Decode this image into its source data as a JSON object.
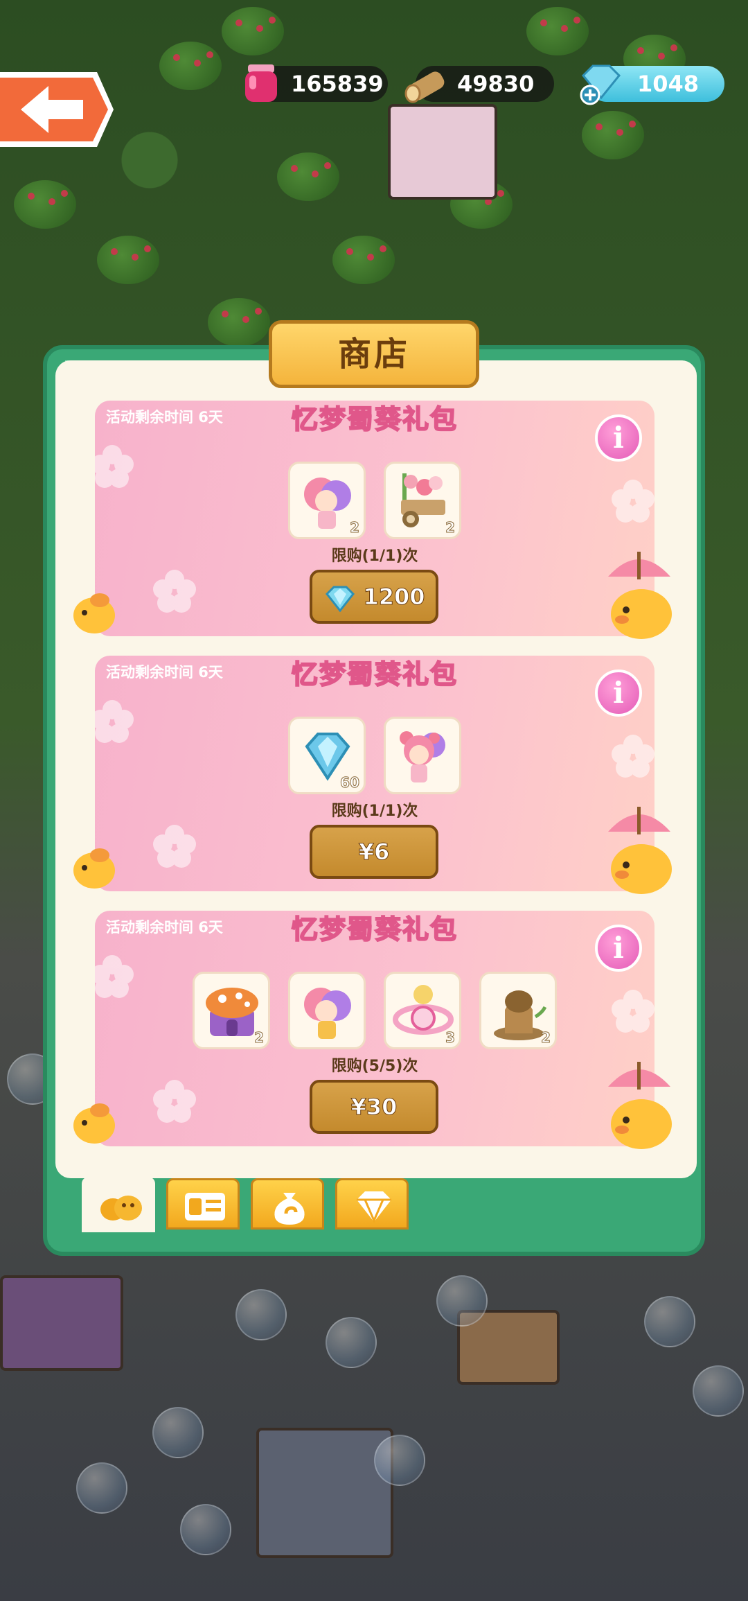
{
  "resources": {
    "potion": {
      "value": "165839",
      "icon": "pink-potion-jar-icon"
    },
    "wood": {
      "value": "49830",
      "icon": "wood-log-icon"
    },
    "gems": {
      "value": "1048",
      "icon": "blue-gem-add-icon"
    }
  },
  "shop": {
    "title": "商店",
    "cards": [
      {
        "timer": "活动剩余时间  6天",
        "title": "忆梦蜀葵礼包",
        "items": [
          {
            "icon": "pink-purple-hair-character-icon",
            "qty": "2"
          },
          {
            "icon": "flower-cart-decoration-icon",
            "qty": "2"
          }
        ],
        "limit": "限购(1/1)次",
        "price": "1200",
        "price_icon": "gem-icon"
      },
      {
        "timer": "活动剩余时间  6天",
        "title": "忆梦蜀葵礼包",
        "items": [
          {
            "icon": "blue-gem-pack-icon",
            "qty": "60"
          },
          {
            "icon": "pink-girl-character-icon",
            "qty": ""
          }
        ],
        "limit": "限购(1/1)次",
        "price": "¥6",
        "price_icon": ""
      },
      {
        "timer": "活动剩余时间  6天",
        "title": "忆梦蜀葵礼包",
        "items": [
          {
            "icon": "mushroom-house-icon",
            "qty": "2"
          },
          {
            "icon": "pink-purple-hair-character-icon",
            "qty": ""
          },
          {
            "icon": "swirl-candy-decoration-icon",
            "qty": "3"
          },
          {
            "icon": "tree-stump-icon",
            "qty": "2"
          }
        ],
        "limit": "限购(5/5)次",
        "price": "¥30",
        "price_icon": ""
      }
    ],
    "tabs": [
      {
        "icon": "chick-group-tab-icon",
        "active": true
      },
      {
        "icon": "card-tab-icon",
        "active": false
      },
      {
        "icon": "money-bag-tab-icon",
        "active": false
      },
      {
        "icon": "diamond-tab-icon",
        "active": false
      }
    ]
  },
  "colors": {
    "panel_green": "#3aa876",
    "card_pink": "#f7b2cb",
    "button_gold": "#d7a24a",
    "info_pink": "#e45bb7"
  }
}
